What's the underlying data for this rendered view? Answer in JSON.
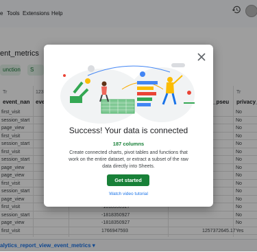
{
  "menu": {
    "items": [
      "e",
      "Tools",
      "Extensions",
      "Help"
    ]
  },
  "sheet": {
    "tab_name": "ent_metrics",
    "toolbar": {
      "function_chip": "unction",
      "second_chip": "S"
    },
    "type_labels": {
      "col1": "Tr",
      "col2": "123",
      "col5": "Tr"
    },
    "columns": [
      "event_nan",
      "eve",
      "_pseu",
      "privacy_"
    ],
    "rows": [
      {
        "name": "first_visit",
        "num": "",
        "pseu": "",
        "privacy": "No"
      },
      {
        "name": "session_start",
        "num": "",
        "pseu": "",
        "privacy": "No"
      },
      {
        "name": "page_view",
        "num": "",
        "pseu": "",
        "privacy": "No"
      },
      {
        "name": "first_visit",
        "num": "",
        "pseu": "",
        "privacy": "No"
      },
      {
        "name": "session_start",
        "num": "",
        "pseu": "",
        "privacy": "No"
      },
      {
        "name": "first_visit",
        "num": "",
        "pseu": "",
        "privacy": "No"
      },
      {
        "name": "session_start",
        "num": "",
        "pseu": "",
        "privacy": "No"
      },
      {
        "name": "page_view",
        "num": "",
        "pseu": "",
        "privacy": "No"
      },
      {
        "name": "page_view",
        "num": "",
        "pseu": "",
        "privacy": "No"
      },
      {
        "name": "first_visit",
        "num": "",
        "pseu": "",
        "privacy": "No"
      },
      {
        "name": "session_start",
        "num": "",
        "pseu": "",
        "privacy": "No"
      },
      {
        "name": "page_view",
        "num": "",
        "pseu": "",
        "privacy": "No"
      },
      {
        "name": "first_visit",
        "num": "-1818350927",
        "pseu": "",
        "privacy": "No"
      },
      {
        "name": "session_start",
        "num": "-1818350927",
        "pseu": "",
        "privacy": "No"
      },
      {
        "name": "page_view",
        "num": "-1818350927",
        "pseu": "",
        "privacy": "No"
      },
      {
        "name": "first_visit",
        "num": "1766947593",
        "pseu": "1257372645.17",
        "privacy": "Yes"
      }
    ],
    "sheet_tab": "alytics_report_view_event_metrics"
  },
  "dialog": {
    "title": "Success! Your data is connected",
    "column_count": "187 columns",
    "description": "Create connected charts, pivot tables and functions that work on the entire dataset, or extract a subset of the raw data directly into Sheets.",
    "primary_button": "Get started",
    "link": "Watch video tutorial"
  },
  "colors": {
    "accent_green": "#188038",
    "link_blue": "#1a73e8"
  }
}
